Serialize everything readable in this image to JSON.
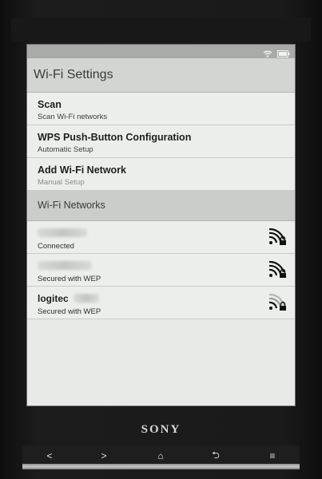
{
  "header": {
    "title": "Wi-Fi Settings"
  },
  "menu": [
    {
      "label": "Scan",
      "sub": "Scan Wi-Fi networks"
    },
    {
      "label": "WPS Push-Button Configuration",
      "sub": "Automatic Setup"
    },
    {
      "label": "Add Wi-Fi Network",
      "sub": "Manual Setup"
    }
  ],
  "section": {
    "label": "Wi-Fi Networks"
  },
  "networks": [
    {
      "name": "",
      "status": "Connected",
      "icon": "wifi-locked-icon"
    },
    {
      "name": "",
      "status": "Secured with WEP",
      "icon": "wifi-locked-icon"
    },
    {
      "name": "logitec",
      "status": "Secured with WEP",
      "icon": "wifi-locked-icon"
    }
  ],
  "brand": "SONY",
  "hardware": [
    {
      "glyph": "<",
      "icon": "back-arrow-icon"
    },
    {
      "glyph": ">",
      "icon": "forward-arrow-icon"
    },
    {
      "glyph": "⌂",
      "icon": "home-icon"
    },
    {
      "glyph": "⮌",
      "icon": "return-icon"
    },
    {
      "glyph": "≡",
      "icon": "menu-icon"
    }
  ]
}
